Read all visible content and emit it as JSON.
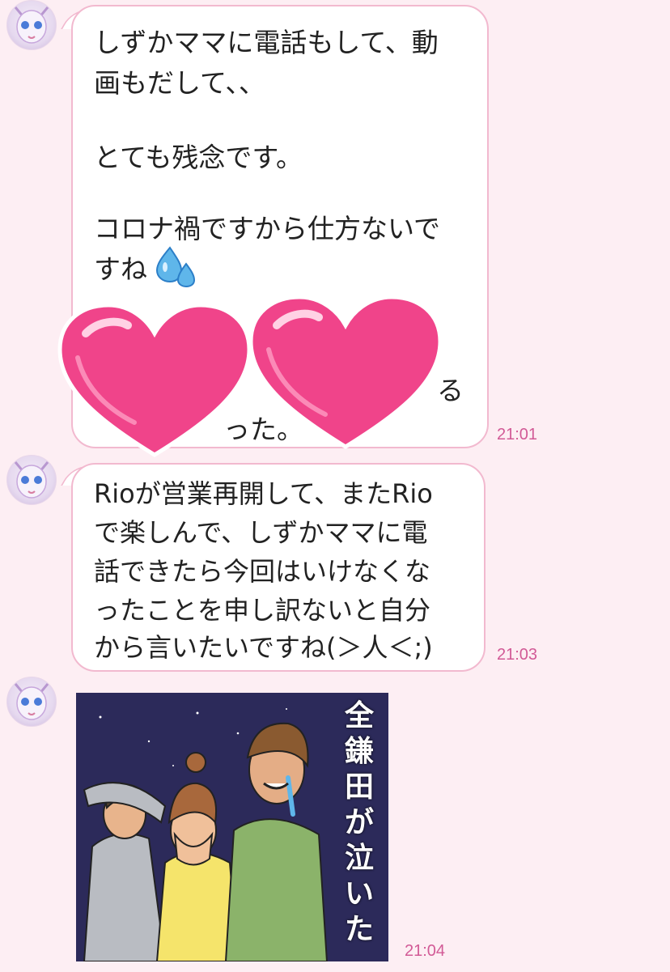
{
  "messages": [
    {
      "lines": [
        "しずかママに電話もして、動",
        "画もだして、、",
        "",
        "とても残念です。",
        "",
        "コロナ禍ですから仕方ないで",
        "すね"
      ],
      "partial_lines": [
        "る",
        "った。"
      ],
      "time": "21:01"
    },
    {
      "lines": [
        "Rioが営業再開して、またRio",
        "で楽しんで、しずかママに電",
        "話できたら今回はいけなくな",
        "ったことを申し訳ないと自分",
        "から言いたいですね(＞人＜;)"
      ],
      "time": "21:03"
    },
    {
      "sticker": {
        "caption": "全鎌田が泣いた",
        "background": "#2c2a5a"
      },
      "time": "21:04"
    }
  ],
  "colors": {
    "background": "#fdeef3",
    "bubble_border": "#f2b9cf",
    "time": "#d25a96",
    "heart": "#f0448a"
  },
  "icons": {
    "drop": "water-drops-icon",
    "heart": "pink-heart-icon"
  }
}
